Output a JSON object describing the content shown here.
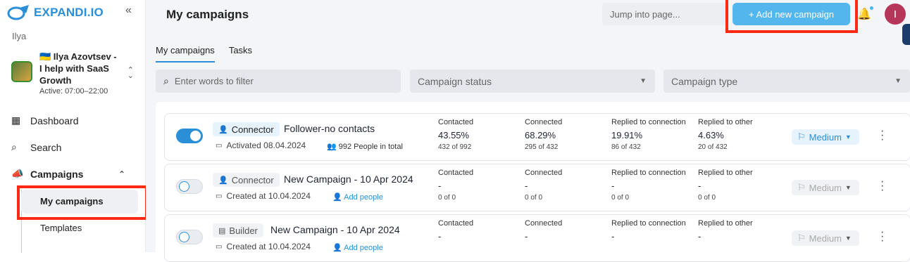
{
  "brand": {
    "name": "EXPANDI.IO"
  },
  "workspace": {
    "name": "Ilya"
  },
  "account": {
    "name": "🇺🇦 Ilya Azovtsev - I help with SaaS Growth",
    "status": "Active: 07:00–22:00"
  },
  "nav": {
    "dashboard": "Dashboard",
    "search": "Search",
    "campaigns": "Campaigns",
    "my_campaigns": "My campaigns",
    "templates": "Templates"
  },
  "header": {
    "title": "My campaigns",
    "jump_placeholder": "Jump into page...",
    "add_button": "+ Add new campaign",
    "user_initial": "I"
  },
  "tabs": [
    "My campaigns",
    "Tasks"
  ],
  "filters": {
    "search_placeholder": "Enter words to filter",
    "status": "Campaign status",
    "type": "Campaign type"
  },
  "stat_labels": [
    "Contacted",
    "Connected",
    "Replied to connection",
    "Replied to other"
  ],
  "campaigns": [
    {
      "type": "Connector",
      "name": "Follower-no contacts",
      "date": "Activated 08.04.2024",
      "people": "992 People in total",
      "stats": [
        {
          "pct": "43.55%",
          "sub": "432 of 992"
        },
        {
          "pct": "68.29%",
          "sub": "295 of 432"
        },
        {
          "pct": "19.91%",
          "sub": "86 of 432"
        },
        {
          "pct": "4.63%",
          "sub": "20 of 432"
        }
      ],
      "priority": "Medium"
    },
    {
      "type": "Connector",
      "name": "New Campaign - 10 Apr 2024",
      "date": "Created at 10.04.2024",
      "people": "Add people",
      "stats": [
        {
          "pct": "-",
          "sub": "0 of 0"
        },
        {
          "pct": "-",
          "sub": "0 of 0"
        },
        {
          "pct": "-",
          "sub": "0 of 0"
        },
        {
          "pct": "-",
          "sub": "0 of 0"
        }
      ],
      "priority": "Medium"
    },
    {
      "type": "Builder",
      "name": "New Campaign - 10 Apr 2024",
      "date": "Created at 10.04.2024",
      "people": "Add people",
      "stats": [
        {
          "pct": "-",
          "sub": ""
        },
        {
          "pct": "-",
          "sub": ""
        },
        {
          "pct": "-",
          "sub": ""
        },
        {
          "pct": "-",
          "sub": ""
        }
      ],
      "priority": "Medium"
    }
  ],
  "colors": {
    "accent": "#2b8fd8",
    "add_button": "#53b6ec",
    "highlight": "#ff2a16"
  }
}
